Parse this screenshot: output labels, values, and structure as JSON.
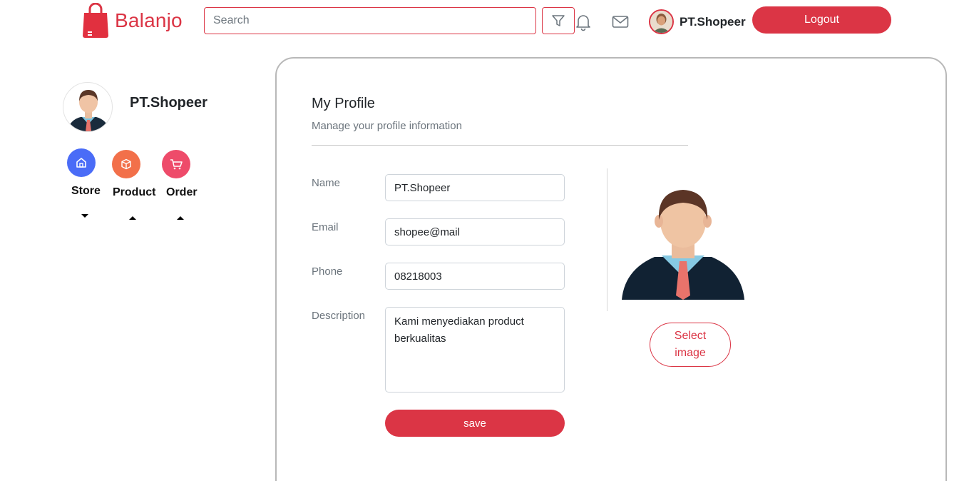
{
  "header": {
    "brand": "Balanjo",
    "search_placeholder": "Search",
    "icons": [
      "filter-icon",
      "bell-icon",
      "mail-icon"
    ],
    "user_name": "PT.Shopeer",
    "logout_label": "Logout"
  },
  "sidebar": {
    "profile_name": "PT.Shopeer",
    "menu": [
      {
        "label": "Store",
        "icon": "store-icon",
        "color": "#4A6CF7",
        "caret": "down"
      },
      {
        "label": "Product",
        "icon": "box-icon",
        "color": "#F2704A",
        "caret": "up"
      },
      {
        "label": "Order",
        "icon": "cart-icon",
        "color": "#EE4B6A",
        "caret": "up"
      }
    ]
  },
  "profile": {
    "title": "My Profile",
    "subtitle": "Manage your profile information",
    "fields": {
      "name": {
        "label": "Name",
        "value": "PT.Shopeer"
      },
      "email": {
        "label": "Email",
        "value": "shopee@mail"
      },
      "phone": {
        "label": "Phone",
        "value": "08218003"
      },
      "description": {
        "label": "Description",
        "value": "Kami menyediakan product berkualitas"
      }
    },
    "save_label": "save",
    "select_image_label": "Select image"
  },
  "colors": {
    "accent": "#DB3545",
    "muted_text": "#6C757D",
    "card_border": "#B8B8B8"
  }
}
